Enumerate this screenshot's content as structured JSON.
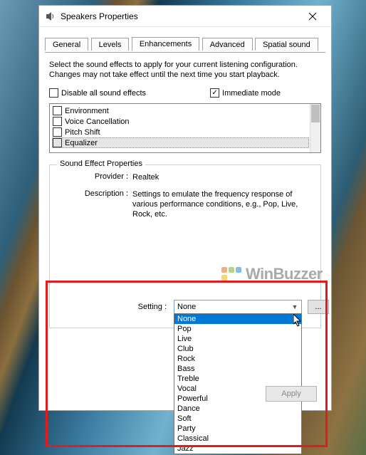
{
  "window": {
    "title": "Speakers Properties"
  },
  "tabs": {
    "general": "General",
    "levels": "Levels",
    "enhancements": "Enhancements",
    "advanced": "Advanced",
    "spatial": "Spatial sound"
  },
  "intro": "Select the sound effects to apply for your current listening configuration. Changes may not take effect until the next time you start playback.",
  "checkboxes": {
    "disable_all": "Disable all sound effects",
    "immediate_mode": "Immediate mode",
    "immediate_checked_glyph": "✓"
  },
  "effects": {
    "items": [
      "Environment",
      "Voice Cancellation",
      "Pitch Shift",
      "Equalizer"
    ]
  },
  "sound_effect_properties": {
    "legend": "Sound Effect Properties",
    "provider_label": "Provider :",
    "provider_value": "Realtek",
    "description_label": "Description :",
    "description_value": "Settings to emulate the frequency response of various performance conditions,  e.g., Pop, Live, Rock, etc."
  },
  "watermark": {
    "text": "WinBuzzer"
  },
  "setting": {
    "label": "Setting :",
    "selected": "None",
    "more_btn": "...",
    "options": [
      "None",
      "Pop",
      "Live",
      "Club",
      "Rock",
      "Bass",
      "Treble",
      "Vocal",
      "Powerful",
      "Dance",
      "Soft",
      "Party",
      "Classical",
      "Jazz"
    ]
  },
  "buttons": {
    "apply": "Apply"
  }
}
